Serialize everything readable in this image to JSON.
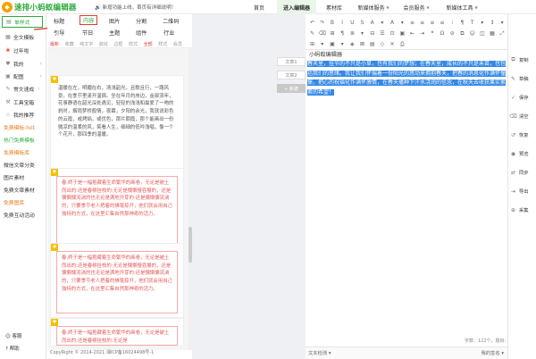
{
  "app": {
    "logo_text": "速排小蚂蚁编辑器",
    "notice": "新增功能上线，首页有详细说明！"
  },
  "nav": [
    {
      "label": "首页",
      "caret": false
    },
    {
      "label": "进入编辑器",
      "caret": false,
      "active": true
    },
    {
      "label": "素材库",
      "caret": false
    },
    {
      "label": "新媒体服务",
      "caret": true
    },
    {
      "label": "会员服务",
      "caret": true
    },
    {
      "label": "新媒体工具",
      "caret": true
    }
  ],
  "sidebar": {
    "items": [
      {
        "label": "单样式",
        "icon": "▤",
        "style": "current"
      },
      {
        "label": "全文模板",
        "icon": "▦"
      },
      {
        "label": "过年啦",
        "icon": "❀",
        "badge": ""
      },
      {
        "label": "我的",
        "icon": "♥",
        "caret": "›"
      },
      {
        "label": "配图",
        "icon": "▣",
        "caret": "›"
      },
      {
        "label": "常文速成",
        "icon": "✎",
        "caret": "›"
      },
      {
        "label": "工具宝箱",
        "icon": "⚒"
      },
      {
        "label": "我的推荐",
        "icon": "☆"
      },
      {
        "label": "免费模板-hot",
        "style": "orange"
      },
      {
        "label": "热门免费模板",
        "style": "green"
      },
      {
        "label": "免费模板库",
        "style": "orange"
      },
      {
        "label": "微信文章分类"
      },
      {
        "label": "图片素材"
      },
      {
        "label": "免费文章素材"
      },
      {
        "label": "免费图库",
        "style": "orange"
      },
      {
        "label": "免费互动活动"
      }
    ],
    "help": [
      {
        "label": "客服",
        "icon": "☺"
      },
      {
        "label": "帮助",
        "icon": "?"
      }
    ]
  },
  "categories": {
    "row1": [
      "标题",
      "内容",
      "图片",
      "分割",
      "二维码"
    ],
    "row2": [
      "引导",
      "节日",
      "主题",
      "组件",
      "行业"
    ],
    "active": "内容"
  },
  "filters": [
    "最新",
    "收藏",
    "纯文字",
    "底纹",
    "边框",
    "样式",
    "全部",
    "样式",
    "会员"
  ],
  "cards": [
    {
      "text": "温暖在左，明媚在右，清浅韶光，且歌且行，一路风景，在季节里漾开温宿。坐在年月的岸边，金部流年，花事静语在韶光深处遇见，轻轻的浅浅和最爱了一吻的刹时，烟雨梦桥般情，夜幕，夕阳的余光，我就说彩色的云霞，或烤焰，或优色，那片朝霞，那个能画出一份微凉的温柔的风，笑看人生，细细的低吟浅唱，像一个个花开，那四季的温暖。"
    },
    {
      "text": "春,终于是一幅抱藏着生命繁华的画卷，无论是被土而出的:还是春柳挂枝的:无论是慵懒慢吞展的，还是慵懒慵流淌的也无论是满地开芽的:还是慵懒慵流淌的，只要季节老人把着的拂笔掠开，他们就会用自己独特的方式，在这里汇集自然那神奇的活力。"
    },
    {
      "text": "春,终于是一幅抱藏着生命繁华的画卷，无论是被土而出的:还是春柳挂枝的:无论是慵懒慢吞展的，还是慵懒慵流淌的也无论是满地开芽的:还是慵懒慵流淌的，只要季节老人把着的拂笔掠开，他们就会用自己独特的方式，在这里汇集自然那神奇的活力。"
    },
    {
      "text": "春,终于是一幅抱藏着生命繁华的画卷，无论是破土而出的:还是春柳挂枝的:无论是"
    }
  ],
  "copyright": "CopyRight © 2014-2021 湘ICP备16024498号-1",
  "middle": {
    "buttons": [
      "文章1",
      "文章2",
      "+ 新建"
    ]
  },
  "editor": {
    "title": "小蚂蚁编辑器",
    "content": "春天里，挂节的不只是小草，也有我们的梦想；在春天里，成长的不只是禾苗，也包括我们的思绪。我让我们怀揣着一份阳光的悠动来拥抱春天，把春的消息化作满怀憧憬，把心的祝福化作满怀激情，在春天播种下汗水浇润的信念，在秋天去收获果实累累的希望！",
    "wordcount": "字数：122个，题目：0张",
    "footer_left": "文本检测",
    "footer_right": "我的签名"
  },
  "toolbar_icons": {
    "row1": [
      "↶",
      "↷",
      "B",
      "I",
      "U",
      "S",
      "A",
      "▾",
      "A",
      "▾",
      "≡",
      "≡",
      "≡",
      "≡",
      "⁝",
      "¶",
      "T",
      "▾",
      "↕",
      "▾"
    ],
    "row2": [
      "✎",
      "⌫",
      "⊞",
      "¶",
      "≣",
      "▾",
      "⊟",
      "☰",
      "⊡",
      "▣",
      "⇤",
      "⇥",
      "❝",
      "Ω",
      "⊘",
      "⧉",
      "☺",
      "◫",
      "▦",
      "⤢"
    ],
    "row3": [
      "⊞",
      "▾",
      "▣",
      "▾",
      "◈",
      "⊠",
      "▤",
      "◇",
      "✕",
      "⎙"
    ]
  },
  "actions": [
    {
      "label": "复制",
      "icon": "⧉"
    },
    {
      "label": "草稿",
      "icon": "✎"
    },
    {
      "label": "保存",
      "icon": "✓"
    },
    {
      "label": "清空",
      "icon": "⌫"
    },
    {
      "label": "恢复",
      "icon": "↺"
    },
    {
      "label": "预览",
      "icon": "◉"
    },
    {
      "label": "同步",
      "icon": "⇄"
    },
    {
      "label": "导出",
      "icon": "⇥"
    },
    {
      "label": "采集",
      "icon": "⊕"
    }
  ]
}
